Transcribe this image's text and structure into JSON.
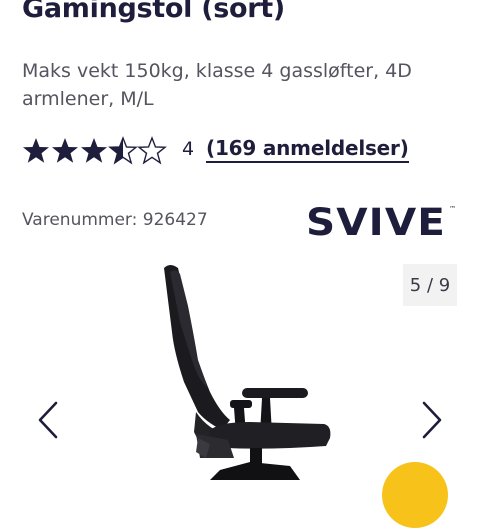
{
  "product": {
    "title": "Gamingstol (sort)",
    "subtitle": "Maks vekt 150kg, klasse 4 gassløfter, 4D armlener, M/L",
    "rating": {
      "value": 3.5,
      "max": 5,
      "score_label": "4",
      "reviews_label": "(169 anmeldelser)"
    },
    "sku_label": "Varenummer: 926427",
    "brand": "SVIVE"
  },
  "gallery": {
    "counter": "5 / 9",
    "image_alt": "black gaming chair side view",
    "prev_icon": "chevron-left-icon",
    "next_icon": "chevron-right-icon"
  },
  "colors": {
    "text_dark": "#1e1e3c",
    "text_muted": "#55555f",
    "accent_yellow": "#f7c21a",
    "counter_bg": "#f2f2f3"
  }
}
